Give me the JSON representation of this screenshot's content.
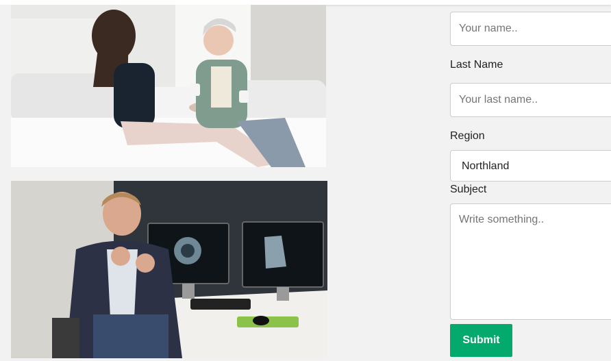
{
  "form": {
    "first_name_placeholder": "Your name..",
    "last_name_label": "Last Name",
    "last_name_placeholder": "Your last name..",
    "region_label": "Region",
    "region_value": "Northland",
    "subject_label": "Subject",
    "subject_placeholder": "Write something..",
    "submit_label": "Submit"
  },
  "colors": {
    "background": "#f2f2f2",
    "submit_button": "#04aa6d",
    "input_border": "#cccccc"
  }
}
